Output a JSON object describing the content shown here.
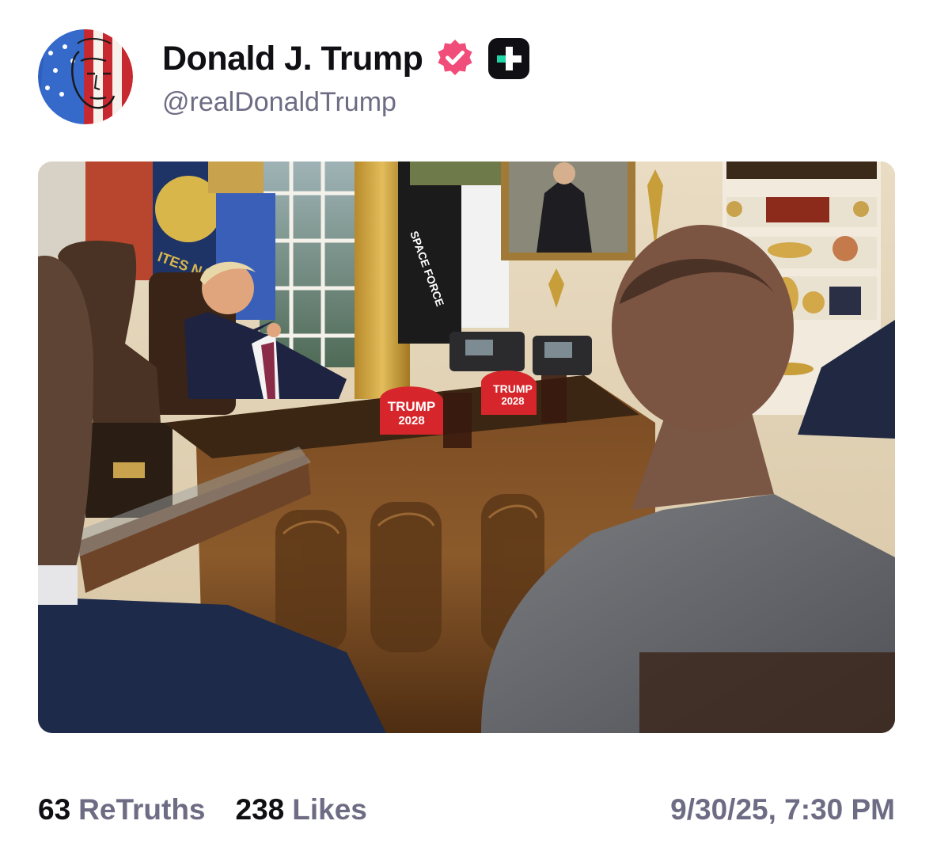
{
  "post": {
    "author": {
      "display_name": "Donald J. Trump",
      "handle": "@realDonaldTrump",
      "avatar_icon": "flag-portrait-avatar",
      "verified_icon": "verified-badge-icon",
      "verified_color": "#f04d7a",
      "app_badge_icon": "truth-social-plus-icon",
      "app_badge_color": "#1fd4a7"
    },
    "media": {
      "hat_text_line1": "TRUMP",
      "hat_text_line2": "2028",
      "flag_text": "SPACE FORCE",
      "seal_text": "ITES NAVY"
    },
    "stats": {
      "retruths_count": "63",
      "retruths_label": "ReTruths",
      "likes_count": "238",
      "likes_label": "Likes"
    },
    "timestamp": "9/30/25, 7:30 PM"
  },
  "colors": {
    "text_primary": "#0f0f14",
    "text_secondary": "#6e6c84",
    "background": "#ffffff"
  }
}
